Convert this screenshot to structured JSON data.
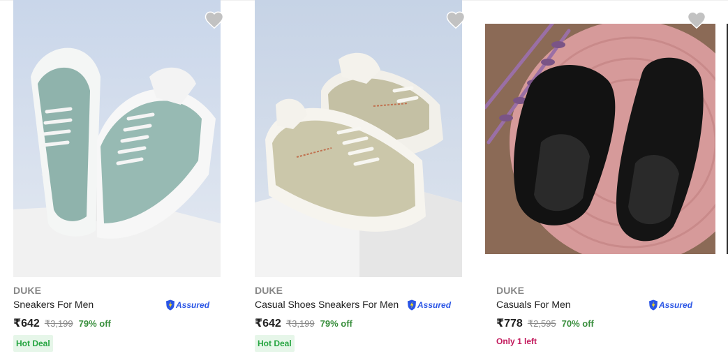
{
  "products": [
    {
      "brand": "DUKE",
      "title": "Sneakers For Men",
      "price": "₹642",
      "mrp": "₹3,199",
      "discount": "79% off",
      "badge": "Hot Deal",
      "assured_label": "Assured",
      "image_icon": "sage-green-sneakers-image"
    },
    {
      "brand": "DUKE",
      "title": "Casual Shoes Sneakers For Men",
      "price": "₹642",
      "mrp": "₹3,199",
      "discount": "79% off",
      "badge": "Hot Deal",
      "assured_label": "Assured",
      "image_icon": "beige-sneakers-image"
    },
    {
      "brand": "DUKE",
      "title": "Casuals For Men",
      "price": "₹778",
      "mrp": "₹2,595",
      "discount": "70% off",
      "stock_note": "Only 1 left",
      "assured_label": "Assured",
      "image_icon": "black-slip-on-loafers-image"
    }
  ],
  "colors": {
    "discount_green": "#388e3c",
    "deal_bg": "#e6f6e9",
    "deal_text": "#26a541",
    "assured_blue": "#2a55e5",
    "stock_pink": "#c2185b",
    "wishlist_grey": "#c2c2c2"
  },
  "icons": {
    "wishlist": "heart-icon",
    "assured": "assured-shield-icon"
  }
}
